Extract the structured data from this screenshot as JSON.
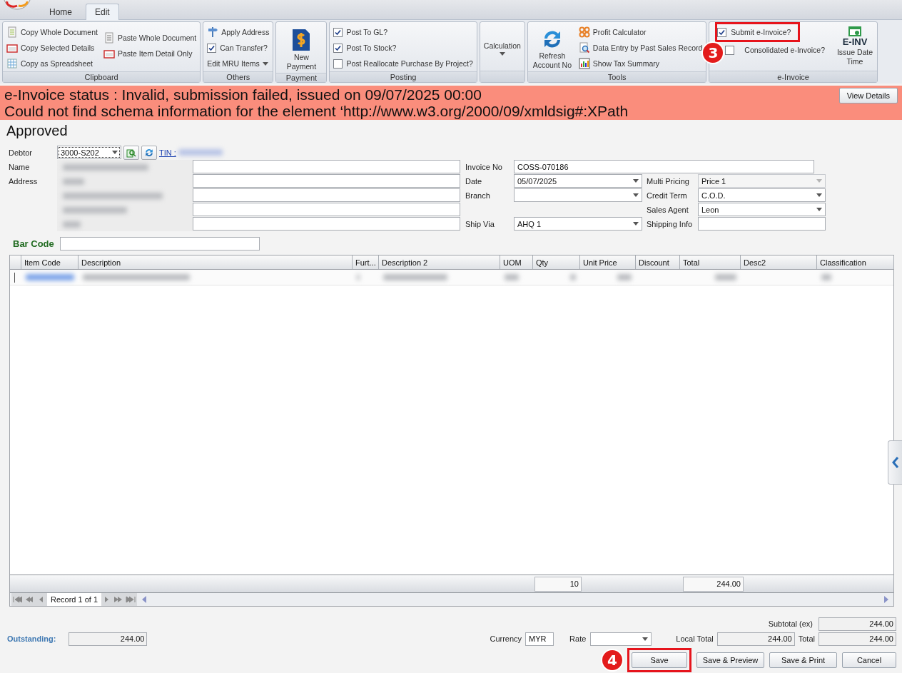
{
  "app_tabs": [
    {
      "label": "Home",
      "selected": false
    },
    {
      "label": "Edit",
      "selected": true
    }
  ],
  "ribbon": [
    {
      "title": "Clipboard",
      "columns": [
        [
          {
            "kind": "button",
            "label": "Copy Whole Document"
          },
          {
            "kind": "button",
            "label": "Copy Selected Details"
          },
          {
            "kind": "button",
            "label": "Copy as Spreadsheet"
          }
        ],
        [
          {
            "kind": "button",
            "label": "Paste Whole Document"
          },
          {
            "kind": "button",
            "label": "Paste Item Detail Only"
          }
        ]
      ]
    },
    {
      "title": "Others",
      "columns": [
        [
          {
            "kind": "button",
            "label": "Apply Address"
          },
          {
            "kind": "check",
            "label": "Can Transfer?",
            "checked": true
          },
          {
            "kind": "menu",
            "label": "Edit MRU Items"
          }
        ]
      ]
    },
    {
      "title": "Payment",
      "columns": [
        [
          {
            "kind": "large",
            "label": "New Payment"
          }
        ]
      ]
    },
    {
      "title": "Posting",
      "columns": [
        [
          {
            "kind": "check",
            "label": "Post To GL?",
            "checked": true
          },
          {
            "kind": "check",
            "label": "Post To Stock?",
            "checked": true
          },
          {
            "kind": "check",
            "label": "Post Reallocate Purchase By Project?",
            "checked": false
          }
        ]
      ]
    },
    {
      "columns": [
        [
          {
            "kind": "large-menu",
            "label": "Calculation"
          }
        ]
      ]
    },
    {
      "title": "Tools",
      "columns": [
        [
          {
            "kind": "large",
            "label": "Refresh Account No"
          }
        ],
        [
          {
            "kind": "button",
            "label": "Profit Calculator"
          },
          {
            "kind": "button",
            "label": "Data Entry by Past Sales Record"
          },
          {
            "kind": "button",
            "label": "Show Tax Summary"
          }
        ]
      ]
    },
    {
      "title": "e-Invoice",
      "columns": [
        [
          {
            "kind": "check",
            "label": "Submit e-Invoice?",
            "checked": true,
            "marker": "3"
          },
          {
            "kind": "check",
            "label": "Consolidated e-Invoice?",
            "checked": false
          }
        ],
        [
          {
            "kind": "large",
            "label": "Issue Date Time",
            "badge": "E-INV"
          }
        ]
      ]
    }
  ],
  "status": {
    "lines": [
      "e-Invoice status : Invalid, submission failed, issued on 09/07/2025 00:00",
      "Could not find schema information for the element ‘http://www.w3.org/2000/09/xmldsig#:XPath"
    ],
    "button": "View Details"
  },
  "heading": "Approved",
  "form": {
    "debtor": {
      "label": "Debtor",
      "value": "3000-S202",
      "tin_label": "TIN :"
    },
    "name_label": "Name",
    "address_label": "Address",
    "middle": [
      {
        "label": "Invoice No",
        "value": "COSS-070186",
        "kind": "text"
      },
      {
        "label": "Date",
        "value": "05/07/2025",
        "kind": "combo"
      },
      {
        "label": "Branch",
        "kind": "combo"
      },
      {
        "label": "Ship Via",
        "value": "AHQ 1",
        "kind": "combo"
      }
    ],
    "right": [
      {
        "label": "Multi Pricing",
        "value": "Price 1",
        "kind": "combo",
        "disabled": true
      },
      {
        "label": "Credit Term",
        "value": "C.O.D.",
        "kind": "combo",
        "disabled": false
      },
      {
        "label": "Sales Agent",
        "value": "Leon",
        "kind": "combo",
        "disabled": false
      },
      {
        "label": "Shipping Info",
        "kind": "text",
        "disabled": false
      }
    ]
  },
  "barcode": {
    "label": "Bar Code"
  },
  "grid": {
    "columns": [
      "Item Code",
      "Description",
      "Furt...",
      "Description 2",
      "UOM",
      "Qty",
      "Unit Price",
      "Discount",
      "Total",
      "Desc2",
      "Classification"
    ],
    "rows": [
      {
        "kind": "blurred"
      }
    ],
    "footer": {
      "qty": "10",
      "total": "244.00"
    },
    "navigator": "Record 1 of 1"
  },
  "bottom": {
    "outstanding": {
      "label": "Outstanding:",
      "value": "244.00"
    },
    "subtotal": {
      "label": "Subtotal (ex)",
      "value": "244.00"
    },
    "currency": {
      "label": "Currency",
      "value": "MYR"
    },
    "rate": {
      "label": "Rate"
    },
    "local_total": {
      "label": "Local Total",
      "value": "244.00"
    },
    "total": {
      "label": "Total",
      "value": "244.00"
    },
    "buttons": [
      {
        "label": "Save",
        "marker": "4"
      },
      {
        "label": "Save & Preview"
      },
      {
        "label": "Save & Print"
      },
      {
        "label": "Cancel"
      }
    ]
  }
}
